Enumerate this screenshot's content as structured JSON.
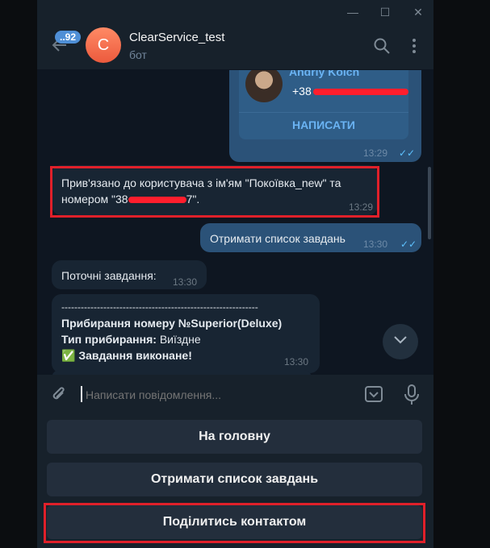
{
  "window": {
    "minimize_label": "—",
    "maximize_label": "☐",
    "close_label": "✕"
  },
  "header": {
    "back_icon": "arrow-left-icon",
    "unread_badge": "..92",
    "avatar_letter": "C",
    "title": "ClearService_test",
    "subtitle": "бот",
    "colors": {
      "avatar": "#ec5a3d",
      "badge": "#4f8fd6"
    }
  },
  "messages": {
    "contact_card": {
      "name": "Andriy Koich",
      "phone_prefix": "+38",
      "write_label": "НАПИСАТИ",
      "time": "13:29"
    },
    "bound_message": {
      "line1": "Прив'язано до користувача з ім'ям \"Покоївка_new\" та",
      "line2_start": "номером \"38",
      "line2_end": "7\".",
      "time": "13:29"
    },
    "outgoing_request": {
      "text": "Отримати список завдань",
      "time": "13:30"
    },
    "current_tasks": {
      "text": "Поточні завдання:",
      "time": "13:30"
    },
    "task_card": {
      "divider": "-------------------------------------------------------------",
      "room_label": "Прибирання номеру №Superior(Deluxe)",
      "type_label": "Тип прибирання:",
      "type_value": "Виїздне",
      "status_icon": "✅",
      "status_text": "Завдання виконане!",
      "time": "13:30"
    }
  },
  "composer": {
    "placeholder": "Написати повідомлення..."
  },
  "keyboard": {
    "buttons": [
      {
        "label": "На головну"
      },
      {
        "label": "Отримати список завдань"
      },
      {
        "label": "Поділитись контактом"
      }
    ]
  },
  "colors": {
    "highlight_box": "#e0202a",
    "accent": "#6ab3f3"
  }
}
